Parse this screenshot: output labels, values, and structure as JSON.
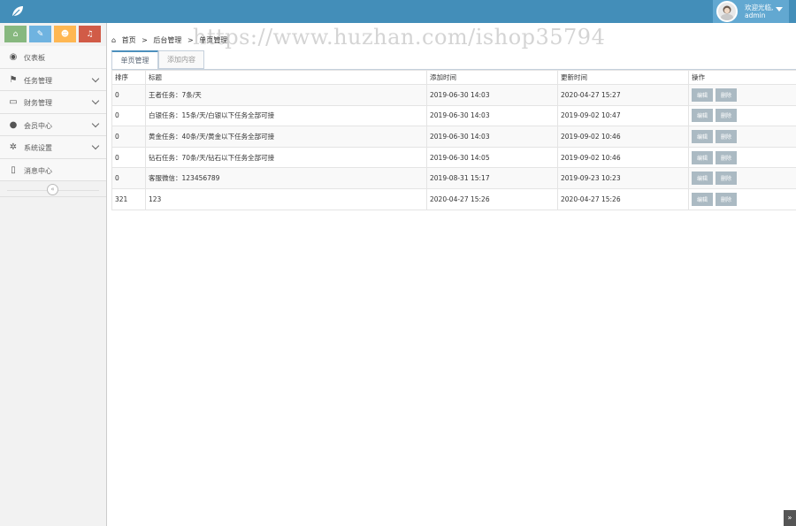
{
  "header": {
    "welcome": "欢迎光临,",
    "username": "admin",
    "watermark": "https://www.huzhan.com/ishop35794"
  },
  "sidebar": {
    "shortcuts": [
      {
        "icon": "home-icon",
        "color": "#87b87f",
        "glyph": "⌂"
      },
      {
        "icon": "pencil-icon",
        "color": "#6fb3e0",
        "glyph": "✎"
      },
      {
        "icon": "users-icon",
        "color": "#ffb752",
        "glyph": "☻"
      },
      {
        "icon": "bell-icon",
        "color": "#d15b47",
        "glyph": "♫"
      }
    ],
    "items": [
      {
        "label": "仪表板",
        "icon": "dashboard-icon",
        "glyph": "◉",
        "has_children": false
      },
      {
        "label": "任务管理",
        "icon": "flag-icon",
        "glyph": "⚑",
        "has_children": true
      },
      {
        "label": "财务管理",
        "icon": "inbox-icon",
        "glyph": "▭",
        "has_children": true
      },
      {
        "label": "会员中心",
        "icon": "user-icon",
        "glyph": "●",
        "has_children": true
      },
      {
        "label": "系统设置",
        "icon": "cog-icon",
        "glyph": "✲",
        "has_children": true
      },
      {
        "label": "消息中心",
        "icon": "bookmark-icon",
        "glyph": "▯",
        "has_children": false
      }
    ],
    "collapse_glyph": "«"
  },
  "breadcrumb": {
    "home": "首页",
    "sep1": ">",
    "level2": "后台管理",
    "sep2": ">",
    "current": "单页管理"
  },
  "tabs": [
    {
      "label": "单页管理",
      "active": true
    },
    {
      "label": "添加内容",
      "active": false
    }
  ],
  "table": {
    "columns": [
      "排序",
      "标题",
      "添加时间",
      "更新时间",
      "操作"
    ],
    "rows": [
      {
        "sort": "0",
        "title": "王者任务：7条/天",
        "added": "2019-06-30 14:03",
        "updated": "2020-04-27 15:27"
      },
      {
        "sort": "0",
        "title": "白银任务：15条/天/白银以下任务全部可接",
        "added": "2019-06-30 14:03",
        "updated": "2019-09-02 10:47"
      },
      {
        "sort": "0",
        "title": "黄金任务：40条/天/黄金以下任务全部可接",
        "added": "2019-06-30 14:03",
        "updated": "2019-09-02 10:46"
      },
      {
        "sort": "0",
        "title": "钻石任务：70条/天/钻石以下任务全部可接",
        "added": "2019-06-30 14:05",
        "updated": "2019-09-02 10:46"
      },
      {
        "sort": "0",
        "title": "客服微信：123456789",
        "added": "2019-08-31 15:17",
        "updated": "2019-09-23 10:23"
      },
      {
        "sort": "321",
        "title": "123",
        "added": "2020-04-27 15:26",
        "updated": "2020-04-27 15:26"
      }
    ],
    "edit_label": "编辑",
    "delete_label": "删除"
  },
  "to_top_glyph": "»"
}
